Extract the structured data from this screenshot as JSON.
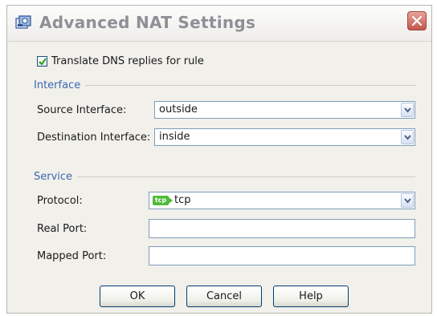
{
  "dialog": {
    "title": "Advanced NAT Settings",
    "icons": {
      "app": "nat-settings-icon",
      "close": "close-icon"
    }
  },
  "translate_dns": {
    "label": "Translate DNS replies for rule",
    "checked": true
  },
  "interface": {
    "section_label": "Interface",
    "source_label": "Source Interface:",
    "source_value": "outside",
    "destination_label": "Destination Interface:",
    "destination_value": "inside"
  },
  "service": {
    "section_label": "Service",
    "protocol_label": "Protocol:",
    "protocol_badge": "tcp",
    "protocol_value": "tcp",
    "real_port_label": "Real Port:",
    "real_port_value": "",
    "mapped_port_label": "Mapped Port:",
    "mapped_port_value": ""
  },
  "buttons": {
    "ok": "OK",
    "cancel": "Cancel",
    "help": "Help"
  },
  "colors": {
    "section_header": "#3b68b0",
    "protocol_badge": "#4fbb3a",
    "close_button": "#c3574b"
  }
}
